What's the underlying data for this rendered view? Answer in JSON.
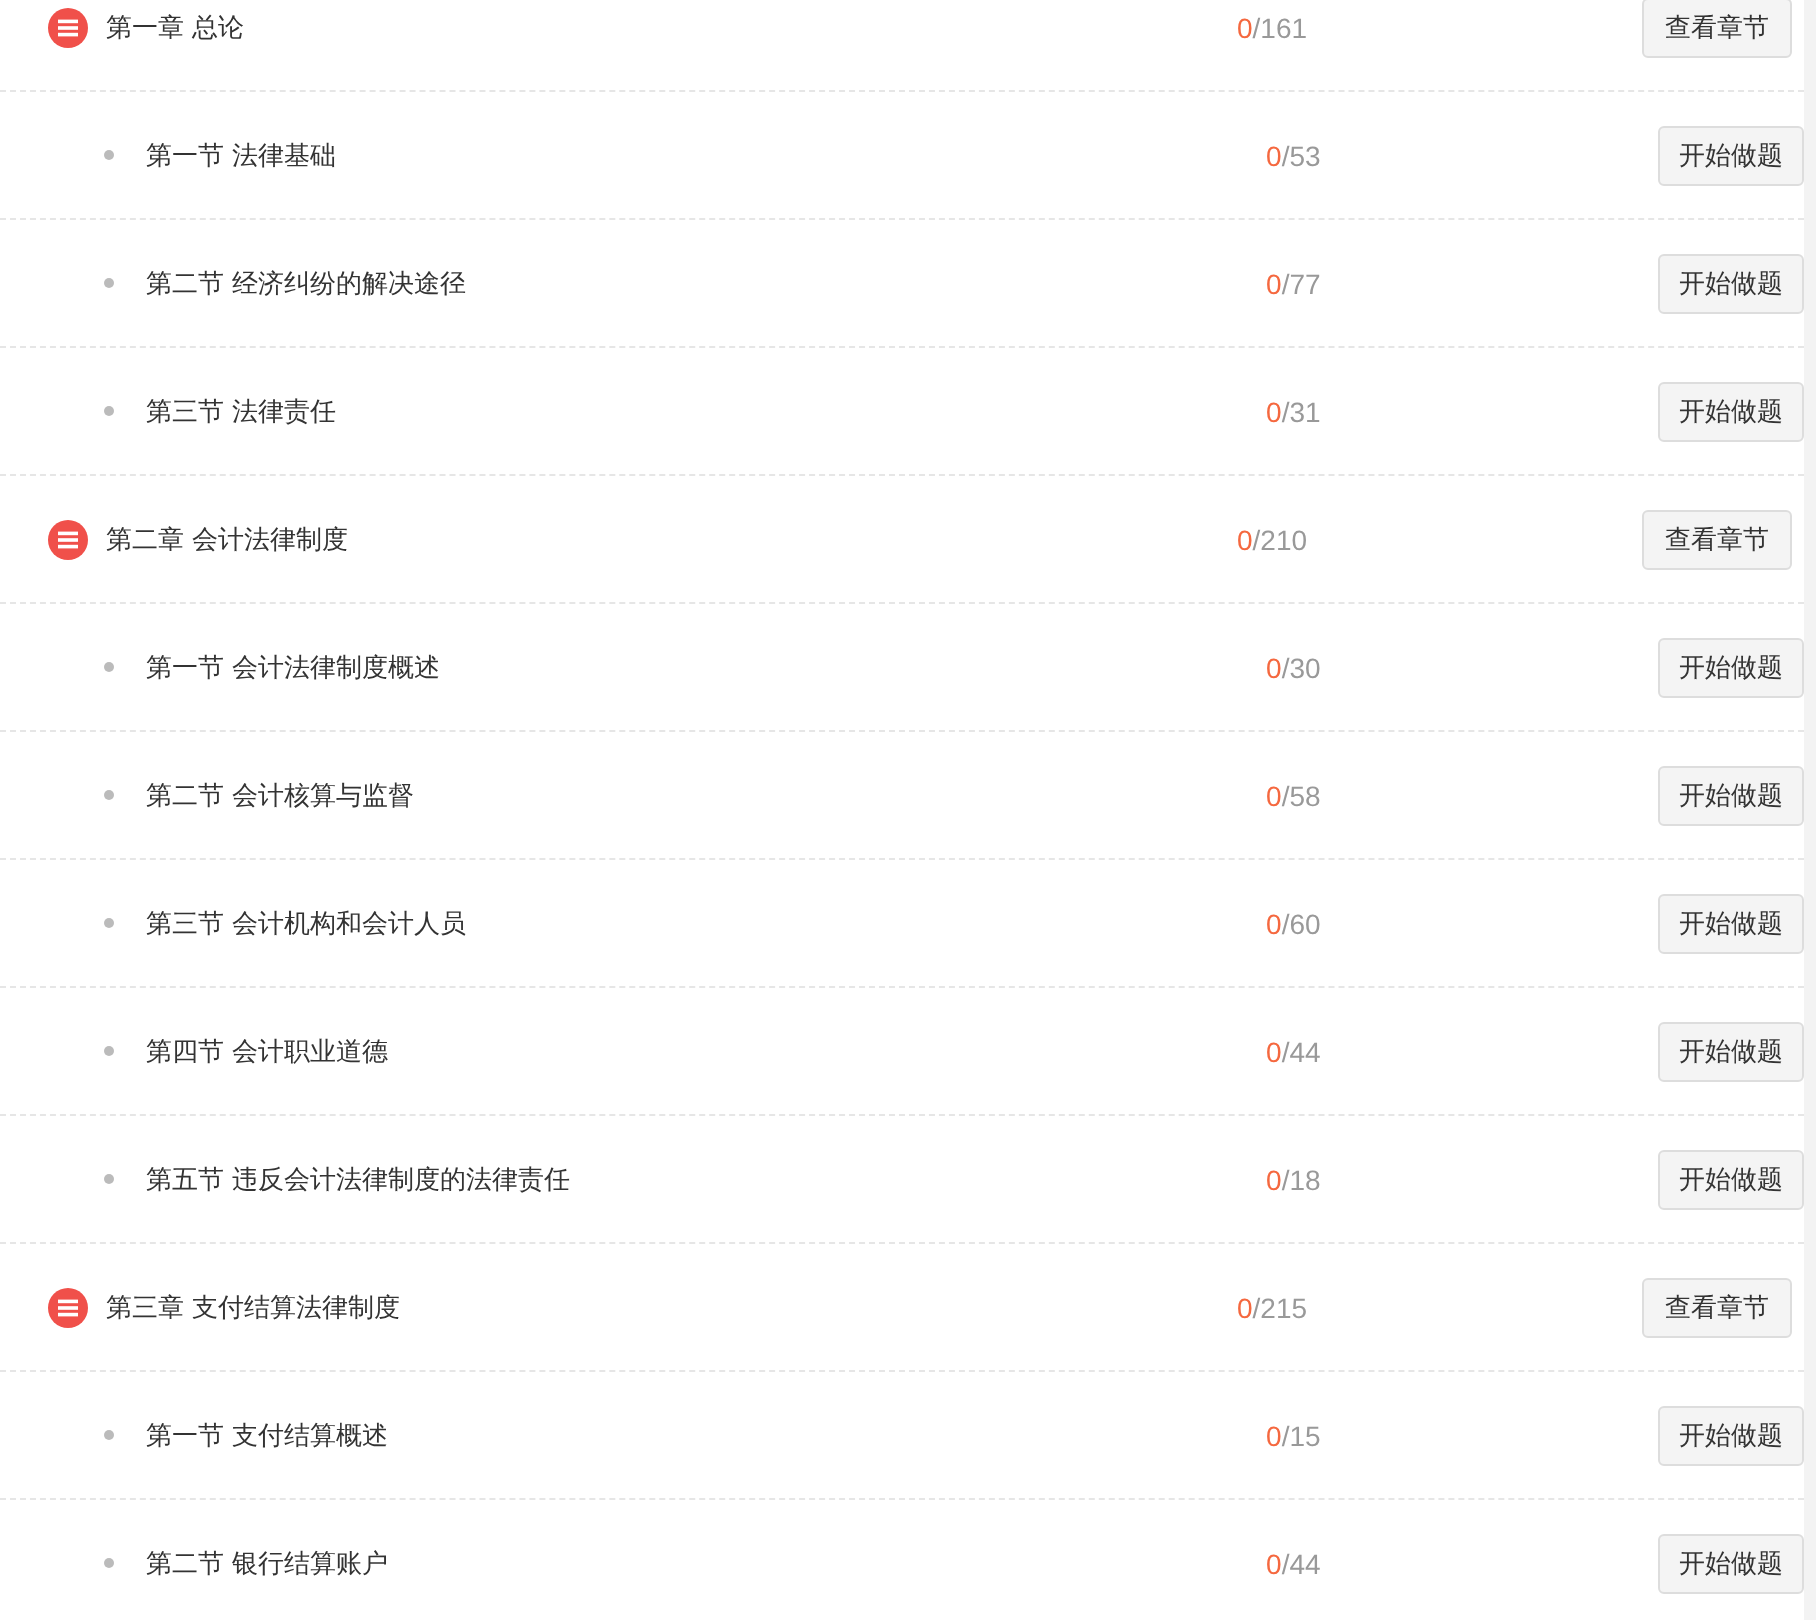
{
  "rows": [
    {
      "kind": "chapter",
      "title": "第一章 总论",
      "done": "0",
      "total": "/161",
      "button": "查看章节"
    },
    {
      "kind": "section",
      "title": "第一节 法律基础",
      "done": "0",
      "total": "/53",
      "button": "开始做题"
    },
    {
      "kind": "section",
      "title": "第二节 经济纠纷的解决途径",
      "done": "0",
      "total": "/77",
      "button": "开始做题"
    },
    {
      "kind": "section",
      "title": "第三节 法律责任",
      "done": "0",
      "total": "/31",
      "button": "开始做题"
    },
    {
      "kind": "chapter",
      "title": "第二章 会计法律制度",
      "done": "0",
      "total": "/210",
      "button": "查看章节"
    },
    {
      "kind": "section",
      "title": "第一节 会计法律制度概述",
      "done": "0",
      "total": "/30",
      "button": "开始做题"
    },
    {
      "kind": "section",
      "title": "第二节 会计核算与监督",
      "done": "0",
      "total": "/58",
      "button": "开始做题"
    },
    {
      "kind": "section",
      "title": "第三节 会计机构和会计人员",
      "done": "0",
      "total": "/60",
      "button": "开始做题"
    },
    {
      "kind": "section",
      "title": "第四节 会计职业道德",
      "done": "0",
      "total": "/44",
      "button": "开始做题"
    },
    {
      "kind": "section",
      "title": "第五节 违反会计法律制度的法律责任",
      "done": "0",
      "total": "/18",
      "button": "开始做题"
    },
    {
      "kind": "chapter",
      "title": "第三章 支付结算法律制度",
      "done": "0",
      "total": "/215",
      "button": "查看章节"
    },
    {
      "kind": "section",
      "title": "第一节 支付结算概述",
      "done": "0",
      "total": "/15",
      "button": "开始做题"
    },
    {
      "kind": "section",
      "title": "第二节 银行结算账户",
      "done": "0",
      "total": "/44",
      "button": "开始做题"
    }
  ]
}
